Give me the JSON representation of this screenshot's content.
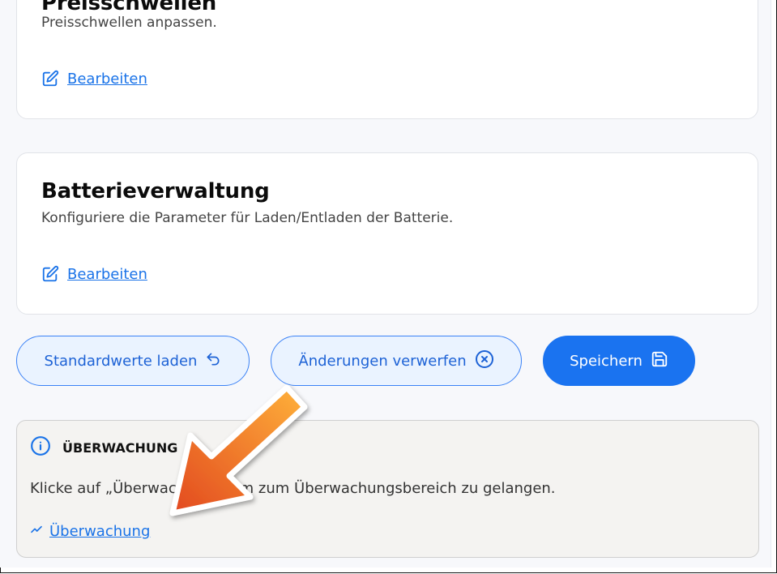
{
  "cards": [
    {
      "title": "Preisschwellen",
      "description": "Preisschwellen anpassen.",
      "edit_label": "Bearbeiten"
    },
    {
      "title": "Batterieverwaltung",
      "description": "Konfiguriere die Parameter für Laden/Entladen der Batterie.",
      "edit_label": "Bearbeiten"
    }
  ],
  "actions": {
    "load_defaults": "Standardwerte laden",
    "discard_changes": "Änderungen verwerfen",
    "save": "Speichern"
  },
  "notice": {
    "title": "ÜBERWACHUNG",
    "text": "Klicke auf „Überwachung“, um zum Überwachungsbereich zu gelangen.",
    "link_label": "Überwachung"
  },
  "icons": {
    "edit": "edit-pencil-icon",
    "undo": "undo-arrow-icon",
    "discard": "x-circle-icon",
    "save": "floppy-disk-icon",
    "info": "info-circle-icon",
    "trend": "trend-line-icon"
  },
  "colors": {
    "accent": "#1a73f0",
    "link": "#1a73e8",
    "outline_button_bg": "#eaf3ff",
    "notice_bg": "#f4f3f1",
    "annotation_arrow": "#f07a1e"
  }
}
